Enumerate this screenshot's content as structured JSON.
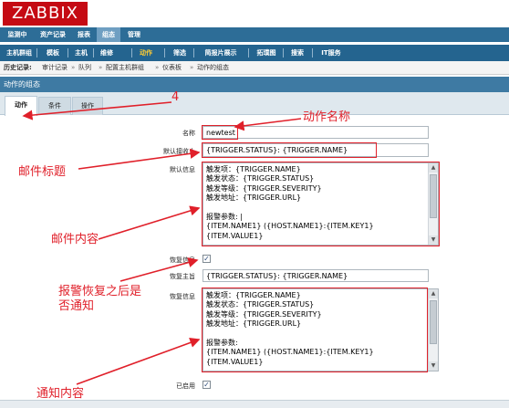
{
  "logo": "ZABBIX",
  "top_nav": [
    "监测中",
    "资产记录",
    "报表",
    "组态",
    "管理"
  ],
  "top_nav_active": "组态",
  "sub_nav": [
    "主机群组",
    "模板",
    "主机",
    "维修",
    "动作",
    "筛选",
    "简报片展示",
    "拓璞图",
    "搜索",
    "IT服务"
  ],
  "sub_nav_active": "动作",
  "history": {
    "label": "历史记录:",
    "items": [
      "审计记录",
      "队列",
      "配置主机群组",
      "仪表板",
      "动作的组态"
    ]
  },
  "section_title": "动作的组态",
  "tabs": [
    "动作",
    "条件",
    "操作"
  ],
  "active_tab": "动作",
  "form": {
    "name_label": "名称",
    "name_value": "newtest",
    "default_subject_label": "默认接收人",
    "default_subject_value": "{TRIGGER.STATUS}: {TRIGGER.NAME}",
    "default_message_label": "默认信息",
    "default_message_lines": [
      "触发项：{TRIGGER.NAME}",
      "触发状态：{TRIGGER.STATUS}",
      "触发等级：{TRIGGER.SEVERITY}",
      "触发地址：{TRIGGER.URL}",
      "",
      "报警参数: |",
      "{ITEM.NAME1} ({HOST.NAME1}:{ITEM.KEY1}",
      "{ITEM.VALUE1}"
    ],
    "recovery_label": "恢复信息",
    "recovery_checked": true,
    "recovery_subject_label": "恢复主旨",
    "recovery_subject_value": "{TRIGGER.STATUS}: {TRIGGER.NAME}",
    "recovery_message_label": "恢复信息",
    "recovery_message_lines": [
      "触发项：{TRIGGER.NAME}",
      "触发状态：{TRIGGER.STATUS}",
      "触发等级：{TRIGGER.SEVERITY}",
      "触发地址：{TRIGGER.URL}",
      "",
      "报警参数:",
      "{ITEM.NAME1} ({HOST.NAME1}:{ITEM.KEY1}",
      "{ITEM.VALUE1}"
    ],
    "enabled_label": "已启用",
    "enabled_checked": true
  },
  "annotations": {
    "tab_number": "4",
    "action_name": "动作名称",
    "mail_subject": "邮件标题",
    "mail_content": "邮件内容",
    "recovery_notify": "报警恢复之后是否通知",
    "notify_content": "通知内容"
  },
  "colors": {
    "logo_red": "#c50a13",
    "nav_blue": "#2d6d97",
    "annotation_red": "#e0202a"
  }
}
